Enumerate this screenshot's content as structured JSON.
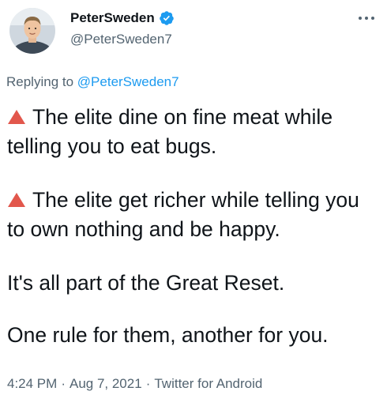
{
  "author": {
    "display_name": "PeterSweden",
    "handle": "@PeterSweden7",
    "avatar_icon": "profile-photo",
    "verified_icon": "verified-badge-icon"
  },
  "more_icon": "more-dots-icon",
  "reply_context": {
    "prefix": "Replying to",
    "mention": "@PeterSweden7"
  },
  "body": {
    "lines": [
      {
        "emoji": "red-triangle-icon",
        "text": "The elite dine on fine meat while telling you to eat bugs."
      },
      {
        "emoji": "red-triangle-icon",
        "text": "The elite get richer while telling you to own nothing and be happy."
      },
      {
        "emoji": "",
        "text": "It's all part of the Great Reset."
      },
      {
        "emoji": "",
        "text": "One rule for them, another for you."
      }
    ]
  },
  "meta": {
    "time": "4:24 PM",
    "separator": "·",
    "date": "Aug 7, 2021",
    "source": "Twitter for Android"
  },
  "colors": {
    "verified_blue": "#1d9bf0",
    "link_blue": "#1d9bf0",
    "secondary_text": "#536471",
    "triangle_red": "#e2574c"
  }
}
